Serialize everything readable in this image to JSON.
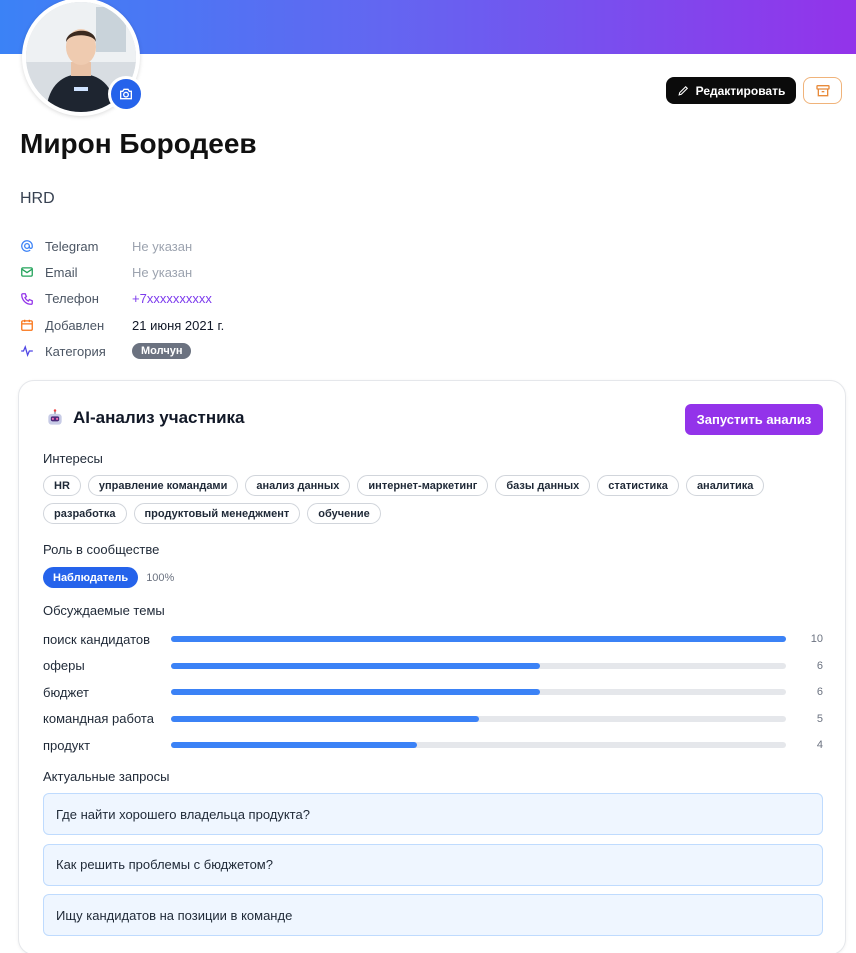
{
  "profile": {
    "name": "Мирон Бородеев",
    "role": "HRD",
    "edit_label": "Редактировать"
  },
  "info": [
    {
      "icon": "at-icon",
      "label": "Telegram",
      "value": "Не указан",
      "style": "muted"
    },
    {
      "icon": "mail-icon",
      "label": "Email",
      "value": "Не указан",
      "style": "muted"
    },
    {
      "icon": "phone-icon",
      "label": "Телефон",
      "value": "+7xxxxxxxxxx",
      "style": "link"
    },
    {
      "icon": "calendar-icon",
      "label": "Добавлен",
      "value": "21 июня 2021 г.",
      "style": "dark"
    },
    {
      "icon": "activity-icon",
      "label": "Категория",
      "value": "Молчун",
      "style": "badge"
    }
  ],
  "analysis": {
    "title": "AI-анализ участника",
    "run_label": "Запустить анализ",
    "interests_label": "Интересы",
    "interests": [
      "HR",
      "управление командами",
      "анализ данных",
      "интернет-маркетинг",
      "базы данных",
      "статистика",
      "аналитика",
      "разработка",
      "продуктовый менеджмент",
      "обучение"
    ],
    "role_label": "Роль в сообществе",
    "role_value": "Наблюдатель",
    "role_percent": "100%",
    "topics_label": "Обсуждаемые темы",
    "topics_max": 10,
    "topics": [
      {
        "name": "поиск кандидатов",
        "count": 10
      },
      {
        "name": "оферы",
        "count": 6
      },
      {
        "name": "бюджет",
        "count": 6
      },
      {
        "name": "командная работа",
        "count": 5
      },
      {
        "name": "продукт",
        "count": 4
      }
    ],
    "queries_label": "Актуальные запросы",
    "queries": [
      "Где найти хорошего владельца продукта?",
      "Как решить проблемы с бюджетом?",
      "Ищу кандидатов на позиции в команде"
    ]
  },
  "colors": {
    "accent_blue": "#2563eb",
    "accent_purple": "#9333ea",
    "bar_fill": "#3b82f6"
  }
}
